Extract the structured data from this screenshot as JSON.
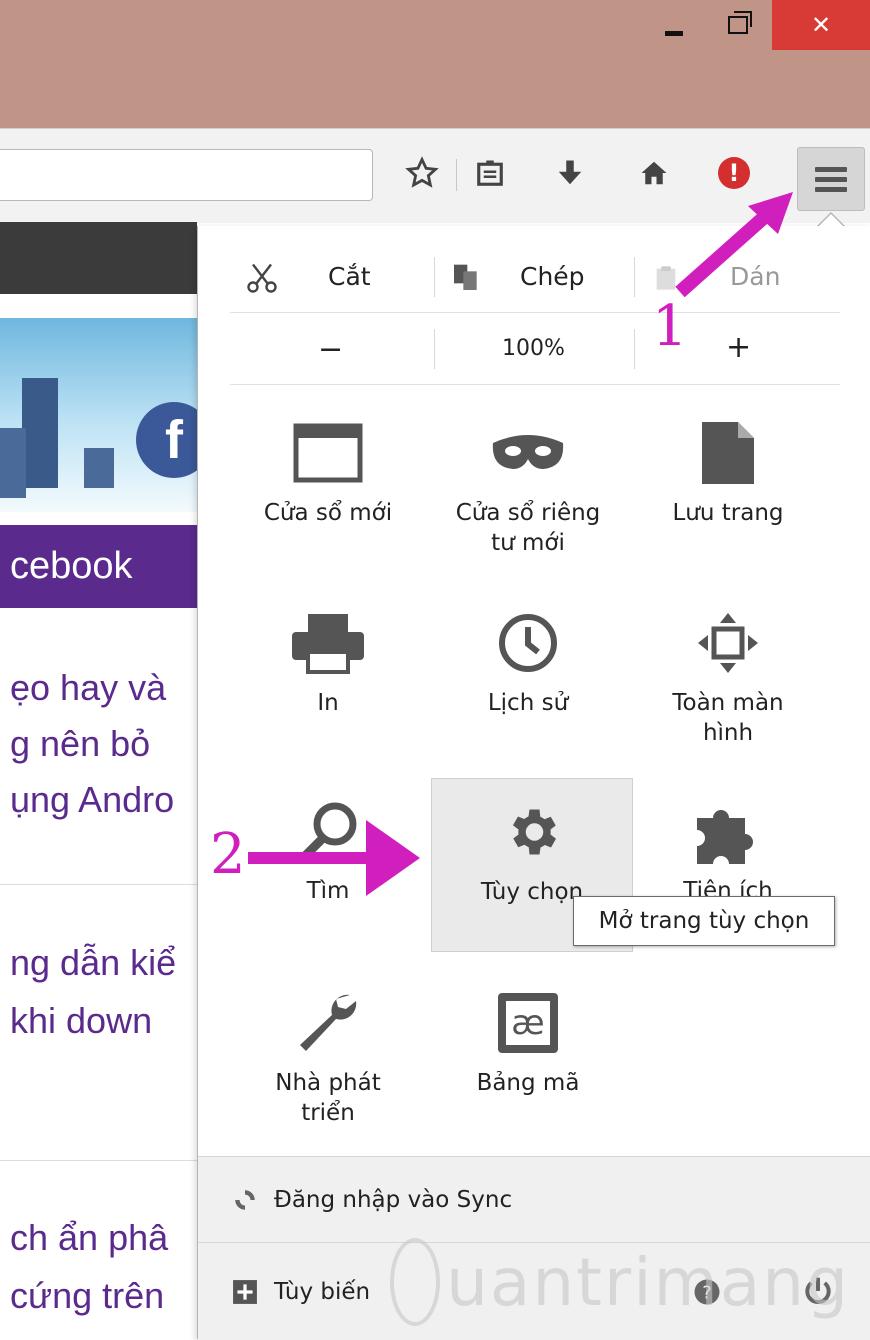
{
  "window": {
    "controls": {
      "minimize": "minimize",
      "maximize": "maximize",
      "close": "✕"
    },
    "colors": {
      "titlebar": "#c19488",
      "close": "#d83b35"
    }
  },
  "toolbar": {
    "icons": [
      "star-icon",
      "reading-list-icon",
      "download-icon",
      "home-icon",
      "alert-icon",
      "menu-icon"
    ],
    "alert_glyph": "!"
  },
  "page": {
    "banner_social": "f",
    "tab_label": "cebook",
    "articles": [
      {
        "lines": [
          "ẹo hay và",
          "g nên bỏ",
          "ụng Andro"
        ]
      },
      {
        "lines": [
          "ng dẫn kiể",
          " khi down"
        ]
      },
      {
        "lines": [
          "ch ẩn phâ",
          "cứng trên"
        ]
      }
    ]
  },
  "menu": {
    "edit": {
      "cut": "Cắt",
      "copy": "Chép",
      "paste": "Dán"
    },
    "zoom": {
      "minus": "−",
      "value": "100%",
      "plus": "+"
    },
    "tiles": [
      {
        "id": "new-window",
        "label": "Cửa sổ mới",
        "icon": "window-icon"
      },
      {
        "id": "private-window",
        "label": "Cửa sổ riêng\ntư mới",
        "icon": "mask-icon"
      },
      {
        "id": "save-page",
        "label": "Lưu trang",
        "icon": "page-icon"
      },
      {
        "id": "print",
        "label": "In",
        "icon": "printer-icon"
      },
      {
        "id": "history",
        "label": "Lịch sử",
        "icon": "clock-icon"
      },
      {
        "id": "fullscreen",
        "label": "Toàn màn\nhình",
        "icon": "fullscreen-icon"
      },
      {
        "id": "find",
        "label": "Tìm",
        "icon": "magnifier-icon"
      },
      {
        "id": "options",
        "label": "Tùy chọn",
        "icon": "gear-icon"
      },
      {
        "id": "addons",
        "label": "Tiện ích",
        "icon": "puzzle-icon"
      },
      {
        "id": "developer",
        "label": "Nhà phát\ntriển",
        "icon": "wrench-icon"
      },
      {
        "id": "encoding",
        "label": "Bảng mã",
        "icon": "encoding-icon",
        "glyph": "æ"
      }
    ],
    "footer": {
      "sync": "Đăng nhập vào Sync",
      "customize": "Tùy biến"
    }
  },
  "tooltip": "Mở trang tùy chọn",
  "annotations": {
    "step1": "1",
    "step2": "2",
    "color": "#d11fbd"
  },
  "watermark": "uantrimang"
}
